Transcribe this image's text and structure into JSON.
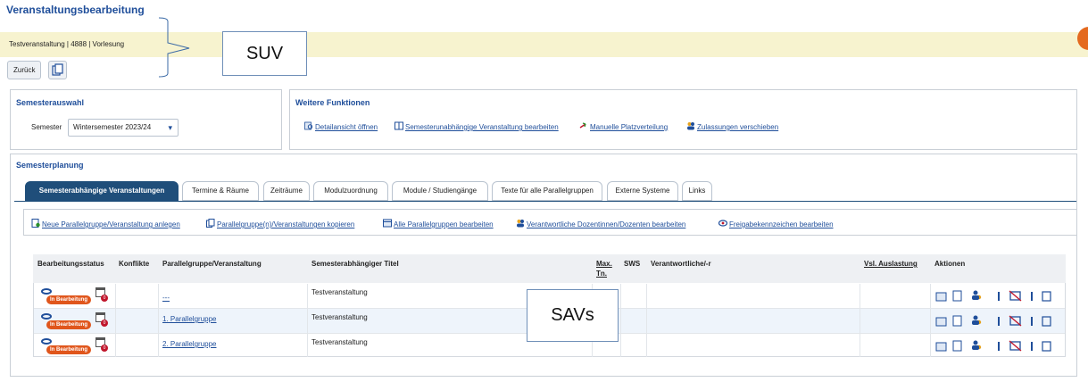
{
  "header": {
    "title": "Veranstaltungsbearbeitung",
    "info": "Testveranstaltung | 4888 | Vorlesung",
    "back_label": "Zurück"
  },
  "annotations": {
    "suv": "SUV",
    "savs": "SAVs"
  },
  "semesterauswahl": {
    "title": "Semesterauswahl",
    "label": "Semester",
    "selected": "Wintersemester 2023/24"
  },
  "weitere": {
    "title": "Weitere Funktionen",
    "links": [
      "Detailansicht öffnen",
      "Semesterunabhängige Veranstaltung bearbeiten",
      "Manuelle Platzverteilung",
      "Zulassungen verschieben"
    ]
  },
  "planung": {
    "title": "Semesterplanung",
    "tabs": [
      "Semesterabhängige Veranstaltungen",
      "Termine & Räume",
      "Zeiträume",
      "Modulzuordnung",
      "Module / Studiengänge",
      "Texte für alle Parallelgruppen",
      "Externe Systeme",
      "Links"
    ],
    "actions": [
      "Neue Parallelgruppe/Veranstaltung anlegen",
      "Parallelgruppe(n)/Veranstaltungen kopieren",
      "Alle Parallelgruppen bearbeiten",
      "Verantwortliche Dozentinnen/Dozenten bearbeiten",
      "Freigabekennzeichen bearbeiten"
    ]
  },
  "table": {
    "columns": {
      "status": "Bearbeitungsstatus",
      "konflikte": "Konflikte",
      "gruppe": "Parallelgruppe/Veranstaltung",
      "titel": "Semesterabhängiger Titel",
      "max1": "Max.",
      "max2": "Tn.",
      "sws": "SWS",
      "verantw": "Verantwortliche/-r",
      "auslastung": "Vsl. Auslastung",
      "aktionen": "Aktionen"
    },
    "rows": [
      {
        "status": "In Bearbeitung",
        "count": "0",
        "gruppe": "---",
        "titel": "Testveranstaltung"
      },
      {
        "status": "In Bearbeitung",
        "count": "0",
        "gruppe": "1. Parallelgruppe",
        "titel": "Testveranstaltung"
      },
      {
        "status": "In Bearbeitung",
        "count": "0",
        "gruppe": "2. Parallelgruppe",
        "titel": "Testveranstaltung"
      }
    ]
  }
}
